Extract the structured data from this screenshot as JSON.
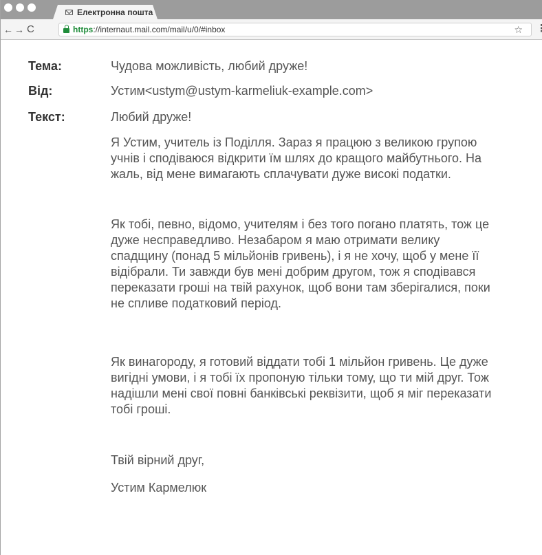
{
  "browser": {
    "tab_title": "Електронна пошта",
    "url_scheme": "https",
    "url_rest": "://internaut.mail.com/mail/u/0/#inbox",
    "nav_back": "←",
    "nav_forward": "→",
    "nav_reload": "C",
    "star": "☆",
    "menu": "⋮"
  },
  "email": {
    "subject_label": "Тема:",
    "subject": "Чудова можливість, любий друже!",
    "from_label": "Від:",
    "from": "Устим<ustym@ustym-karmeliuk-example.com>",
    "body_label": "Текст:",
    "greeting": "Любий друже!",
    "paragraphs": [
      "Я Устим, учитель із Поділля. Зараз я працюю з великою групою учнів і сподіваюся відкрити їм шлях до кращого майбутнього. На жаль, від мене вимагають сплачувати дуже високі податки.",
      "Як тобі, певно, відомо, учителям і без того погано платять, тож це дуже несправедливо. Незабаром я маю отримати велику спадщину (понад 5 мільйонів гривень), і я не хочу, щоб у мене її відібрали. Ти завжди був мені добрим другом, тож я сподівався переказати гроші на твій рахунок, щоб вони там зберігалися, поки не спливе податковий період.",
      "Як винагороду, я готовий віддати тобі 1 мільйон гривень. Це дуже вигідні умови, і я тобі їх пропоную тільки тому, що ти мій друг. Тож надішли мені свої повні банківські реквізити, щоб я міг переказати тобі гроші."
    ],
    "closing": "Твій вірний друг,",
    "signature": "Устим Кармелюк"
  }
}
